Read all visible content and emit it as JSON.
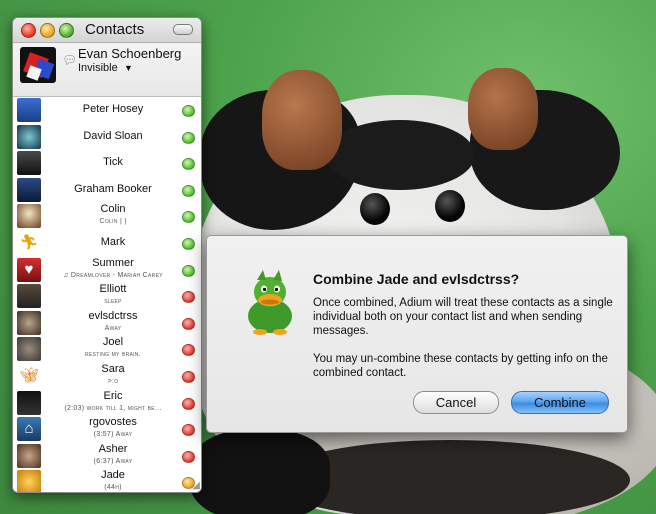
{
  "window": {
    "title": "Contacts",
    "account": {
      "name": "Evan Schoenberg",
      "status": "Invisible"
    }
  },
  "contacts": [
    {
      "name": "Peter Hosey",
      "status": "",
      "presence": "green"
    },
    {
      "name": "David Sloan",
      "status": "",
      "presence": "green"
    },
    {
      "name": "Tick",
      "status": "",
      "presence": "green"
    },
    {
      "name": "Graham Booker",
      "status": "",
      "presence": "green"
    },
    {
      "name": "Colin",
      "status": "Colin | |",
      "presence": "green"
    },
    {
      "name": "Mark",
      "status": "",
      "presence": "green"
    },
    {
      "name": "Summer",
      "status": "♫ Dreamlover - Mariah Carey",
      "presence": "green"
    },
    {
      "name": "Elliott",
      "status": "sleep",
      "presence": "red"
    },
    {
      "name": "evlsdctrss",
      "status": "Away",
      "presence": "red"
    },
    {
      "name": "Joel",
      "status": "resting my brain.",
      "presence": "red"
    },
    {
      "name": "Sara",
      "status": ">:o",
      "presence": "red"
    },
    {
      "name": "Eric",
      "status": "(2:03) work till 1, might be...",
      "presence": "red"
    },
    {
      "name": "rgovostes",
      "status": "(3:57) Away",
      "presence": "red"
    },
    {
      "name": "Asher",
      "status": "(6:37) Away",
      "presence": "red"
    },
    {
      "name": "Jade",
      "status": "(44h)",
      "presence": "yellow"
    }
  ],
  "presence_colors": {
    "green": "#4cbb2a",
    "red": "#e1352a",
    "yellow": "#e9a21c"
  },
  "dialog": {
    "title": "Combine Jade and evlsdctrss?",
    "message1": "Once combined, Adium will treat these contacts as a single individual both on your contact list and when sending messages.",
    "message2": "You may un-combine these contacts by getting info on the combined contact.",
    "cancel_label": "Cancel",
    "combine_label": "Combine",
    "icon": "adium-duck-icon"
  }
}
